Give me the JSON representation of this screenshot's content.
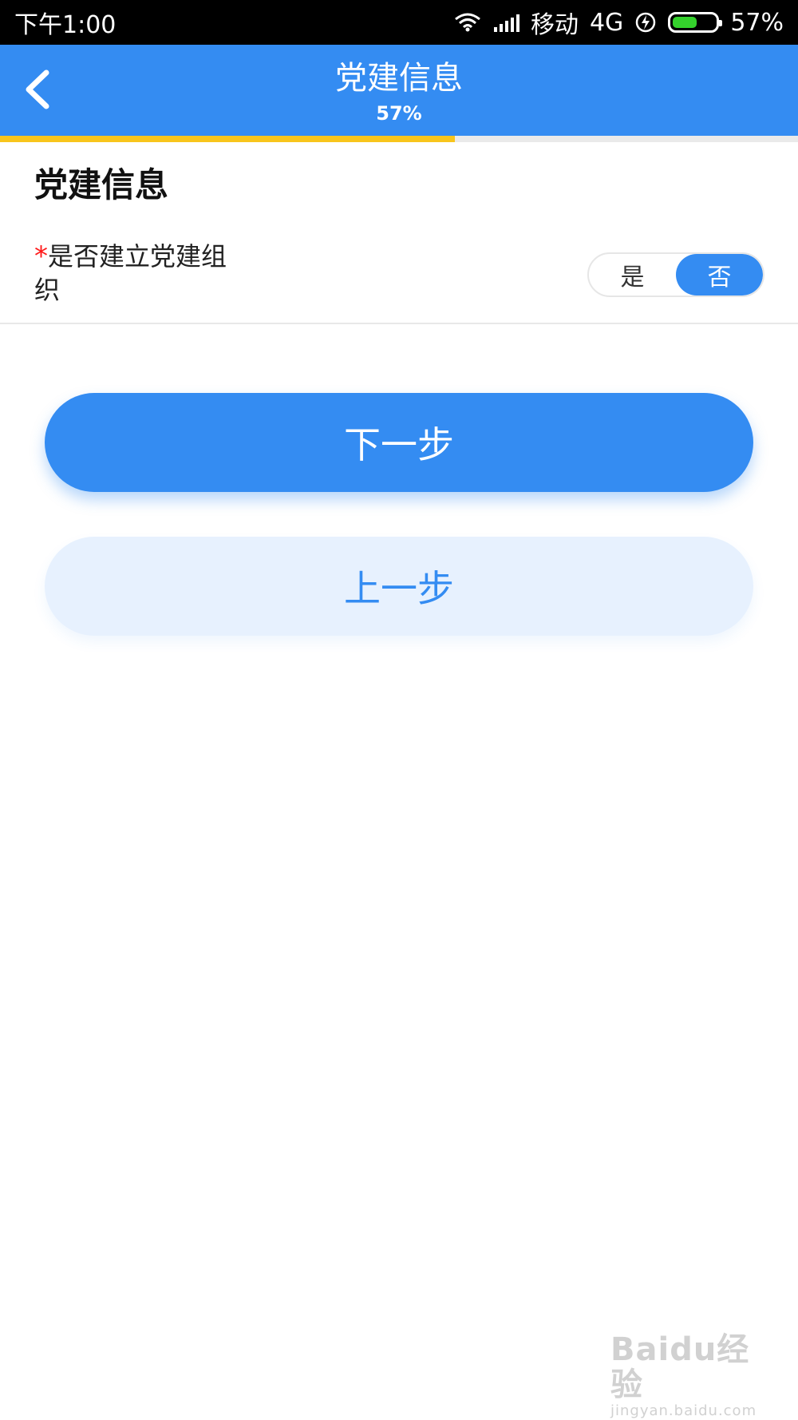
{
  "status_bar": {
    "time": "下午1:00",
    "carrier": "移动",
    "network": "4G",
    "battery_percent_text": "57%",
    "battery_level": 0.57,
    "icons": [
      "wifi-icon",
      "signal-icon",
      "charging-icon",
      "battery-icon"
    ]
  },
  "header": {
    "title": "党建信息",
    "progress_text": "57%",
    "progress_value": 0.57,
    "back_icon": "back-chevron-icon"
  },
  "section": {
    "title": "党建信息",
    "question": {
      "required_mark": "*",
      "label": "是否建立党建组织",
      "options": [
        "是",
        "否"
      ],
      "selected": "否"
    }
  },
  "buttons": {
    "next": "下一步",
    "prev": "上一步"
  },
  "watermark": {
    "logo": "Baidu经验",
    "url": "jingyan.baidu.com"
  },
  "colors": {
    "primary": "#348cf2",
    "progress": "#f8c51c",
    "required": "#ff1a1a",
    "secondary_bg": "#e7f1fe"
  }
}
